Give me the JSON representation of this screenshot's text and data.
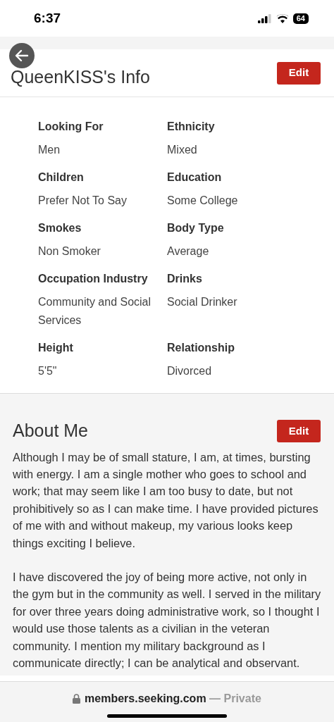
{
  "status_bar": {
    "time": "6:37",
    "battery": "64"
  },
  "info": {
    "title": "QueenKISS's Info",
    "edit_label": "Edit",
    "fields": [
      {
        "label": "Looking For",
        "value": "Men"
      },
      {
        "label": "Ethnicity",
        "value": "Mixed"
      },
      {
        "label": "Children",
        "value": "Prefer Not To Say"
      },
      {
        "label": "Education",
        "value": "Some College"
      },
      {
        "label": "Smokes",
        "value": "Non Smoker"
      },
      {
        "label": "Body Type",
        "value": "Average"
      },
      {
        "label": "Occupation Industry",
        "value": "Community and Social Services"
      },
      {
        "label": "Drinks",
        "value": "Social Drinker"
      },
      {
        "label": "Height",
        "value": "5'5\""
      },
      {
        "label": "Relationship",
        "value": "Divorced"
      }
    ]
  },
  "about": {
    "title": "About Me",
    "edit_label": "Edit",
    "paragraphs": [
      "Although I may be of small stature, I am, at times, bursting with energy. I am a single mother who goes to school and work; that may seem like I am too busy to date, but not prohibitively so as I can make time. I have provided pictures of me with and without makeup, my various looks keep things exciting I believe.",
      "I have discovered the joy of being more active, not only in the gym but in the community as well. I served in the military for over three years doing administrative work, so I thought I would use those talents as a civilian in the veteran community. I mention my military background as I communicate directly; I can be analytical and observant."
    ]
  },
  "browser_bar": {
    "domain": "members.seeking.com",
    "suffix": "— Private"
  }
}
